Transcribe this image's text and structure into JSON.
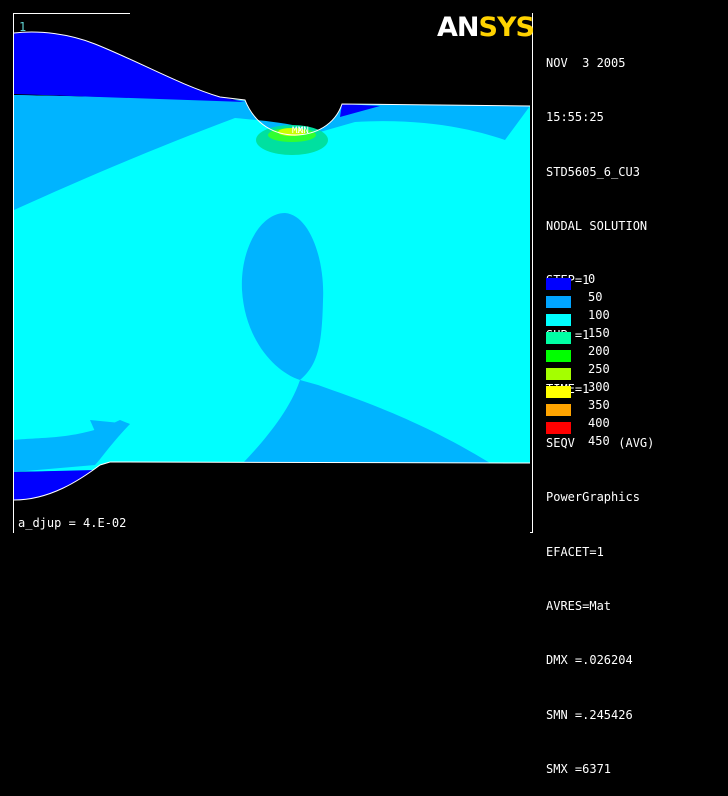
{
  "window_number": "1",
  "logo": {
    "part1": "AN",
    "part2": "SYS"
  },
  "info_lines": [
    "NOV  3 2005",
    "15:55:25",
    "STD5605_6_CU3",
    "NODAL SOLUTION",
    "STEP=1",
    "SUB =1",
    "TIME=1",
    "SEQV      (AVG)",
    "PowerGraphics",
    "EFACET=1",
    "AVRES=Mat",
    "DMX =.026204",
    "SMN =.245426",
    "SMX =6371"
  ],
  "legend": [
    {
      "value": "0",
      "color": "#0000ff"
    },
    {
      "value": "50",
      "color": "#00a4ff"
    },
    {
      "value": "100",
      "color": "#00ffff"
    },
    {
      "value": "150",
      "color": "#00ffa4"
    },
    {
      "value": "200",
      "color": "#00ff00"
    },
    {
      "value": "250",
      "color": "#a4ff00"
    },
    {
      "value": "300",
      "color": "#ffff00"
    },
    {
      "value": "350",
      "color": "#ffa400"
    },
    {
      "value": "400",
      "color": "#ff0000"
    },
    {
      "value": "450",
      "color": ""
    }
  ],
  "max_marker": "MX",
  "min_marker": "MN",
  "caption": "a_djup = 4.E-02"
}
